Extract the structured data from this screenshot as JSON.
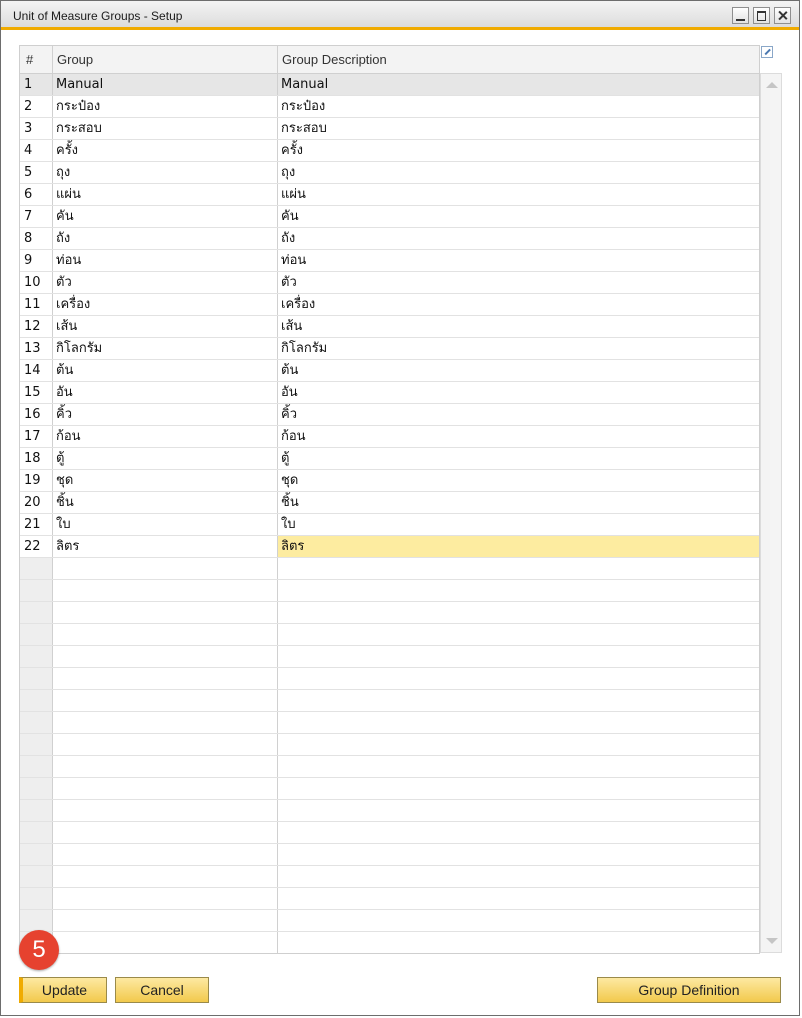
{
  "window": {
    "title": "Unit of Measure Groups - Setup"
  },
  "grid": {
    "headers": [
      "#",
      "Group",
      "Group Description"
    ],
    "rows": [
      {
        "num": "1",
        "group": "Manual",
        "desc": "Manual"
      },
      {
        "num": "2",
        "group": "กระป๋อง",
        "desc": "กระป๋อง"
      },
      {
        "num": "3",
        "group": "กระสอบ",
        "desc": "กระสอบ"
      },
      {
        "num": "4",
        "group": "ครั้ง",
        "desc": "ครั้ง"
      },
      {
        "num": "5",
        "group": "ถุง",
        "desc": "ถุง"
      },
      {
        "num": "6",
        "group": "แผ่น",
        "desc": "แผ่น"
      },
      {
        "num": "7",
        "group": "คัน",
        "desc": "คัน"
      },
      {
        "num": "8",
        "group": "ถัง",
        "desc": "ถัง"
      },
      {
        "num": "9",
        "group": "ท่อน",
        "desc": "ท่อน"
      },
      {
        "num": "10",
        "group": "ตัว",
        "desc": "ตัว"
      },
      {
        "num": "11",
        "group": "เครื่อง",
        "desc": "เครื่อง"
      },
      {
        "num": "12",
        "group": "เส้น",
        "desc": "เส้น"
      },
      {
        "num": "13",
        "group": "กิโลกรัม",
        "desc": "กิโลกรัม"
      },
      {
        "num": "14",
        "group": "ต้น",
        "desc": "ต้น"
      },
      {
        "num": "15",
        "group": "อัน",
        "desc": "อัน"
      },
      {
        "num": "16",
        "group": "คิ้ว",
        "desc": "คิ้ว"
      },
      {
        "num": "17",
        "group": "ก้อน",
        "desc": "ก้อน"
      },
      {
        "num": "18",
        "group": "ตู้",
        "desc": "ตู้"
      },
      {
        "num": "19",
        "group": "ชุด",
        "desc": "ชุด"
      },
      {
        "num": "20",
        "group": "ชิ้น",
        "desc": "ชิ้น"
      },
      {
        "num": "21",
        "group": "ใบ",
        "desc": "ใบ"
      },
      {
        "num": "22",
        "group": "ลิตร",
        "desc": "ลิตร"
      }
    ]
  },
  "annotation": {
    "step": "5"
  },
  "buttons": {
    "update": "Update",
    "cancel": "Cancel",
    "group_definition": "Group Definition"
  }
}
